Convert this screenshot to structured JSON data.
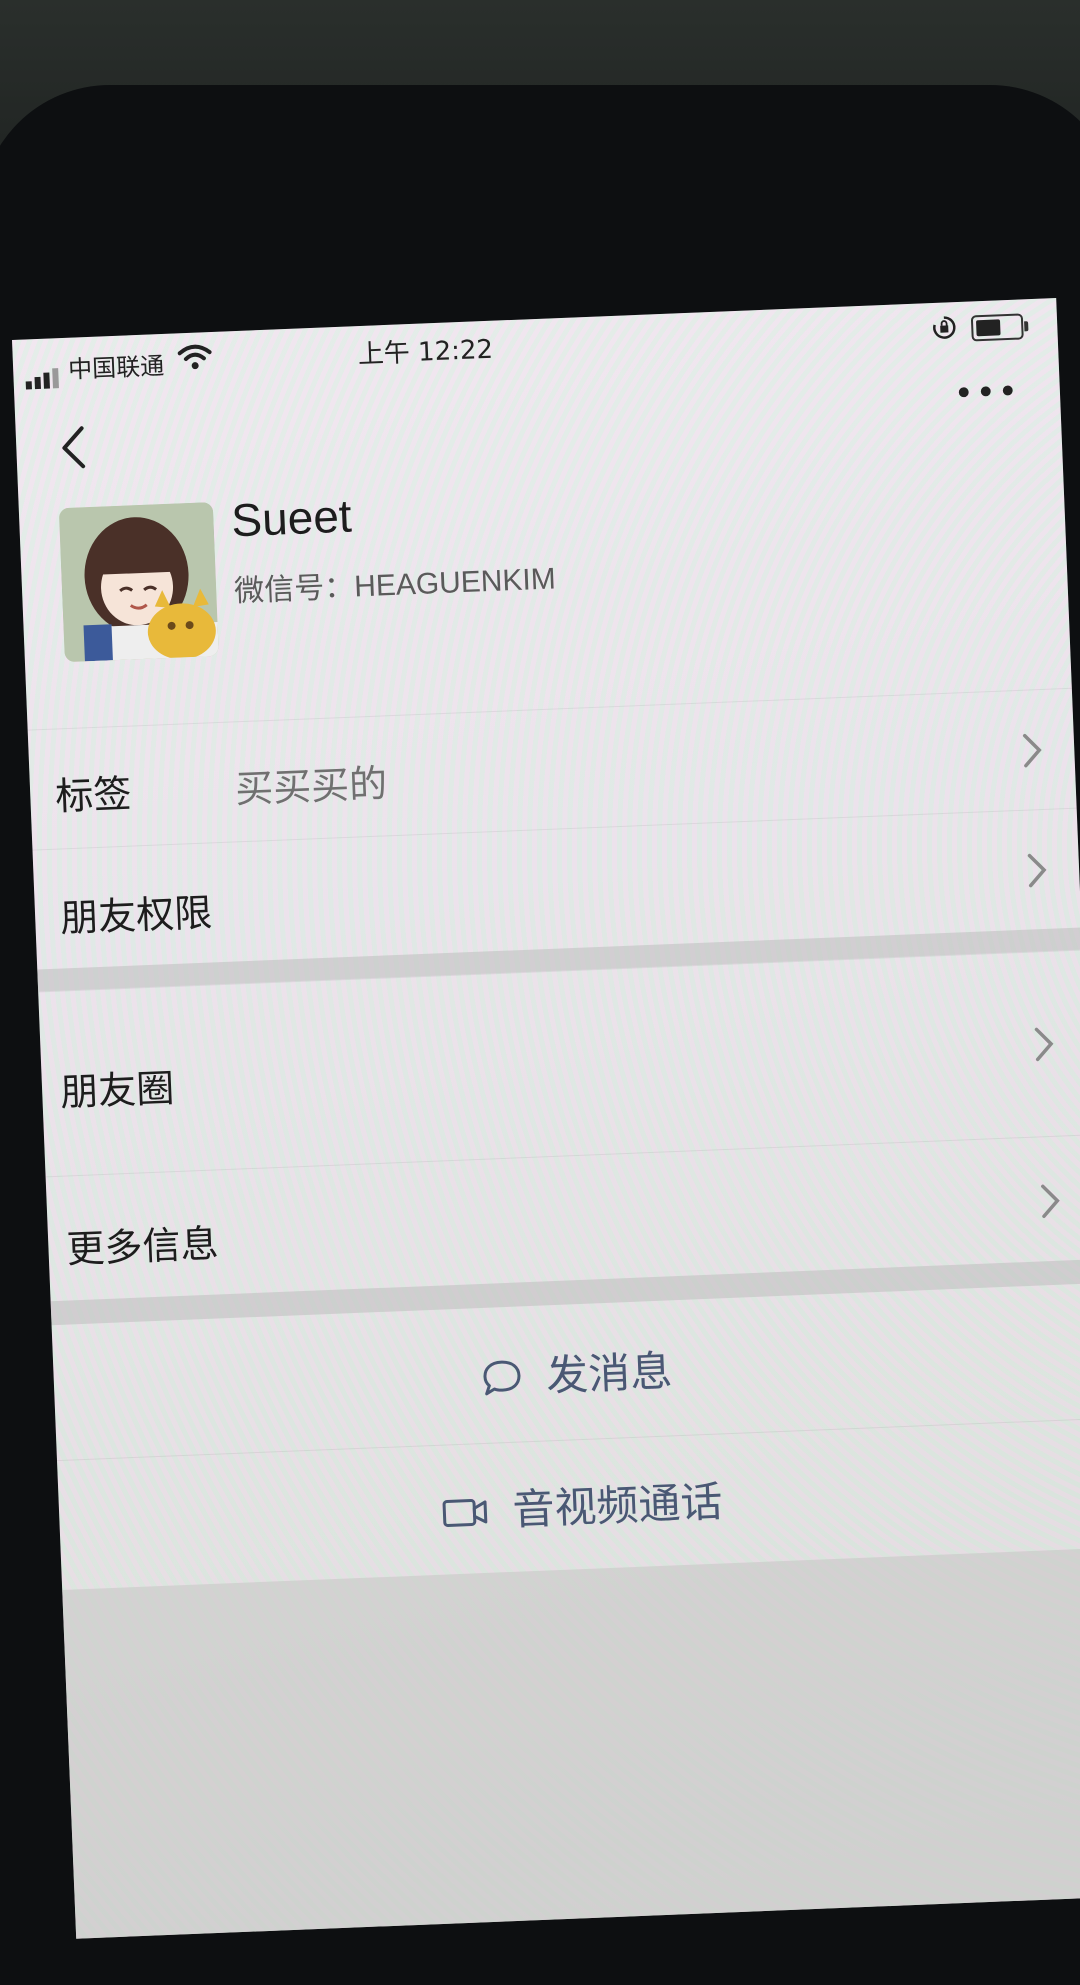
{
  "status_bar": {
    "carrier": "中国联通",
    "time": "上午 12:22"
  },
  "profile": {
    "name": "Sueet",
    "wechat_id": "微信号：HEAGUENKIM"
  },
  "rows": {
    "tags": {
      "label": "标签",
      "value": "买买买的"
    },
    "permissions": {
      "label": "朋友权限"
    },
    "moments": {
      "label": "朋友圈"
    },
    "more_info": {
      "label": "更多信息"
    }
  },
  "actions": {
    "send_message": "发消息",
    "av_call": "音视频通话"
  },
  "colors": {
    "action_text": "#4a5874",
    "label_text": "#1d1d1d",
    "value_text": "#707070"
  },
  "icons": [
    "signal-icon",
    "wifi-icon",
    "orientation-lock-icon",
    "battery-icon",
    "back-icon",
    "more-icon",
    "chevron-right-icon",
    "chat-bubble-icon",
    "video-camera-icon"
  ]
}
